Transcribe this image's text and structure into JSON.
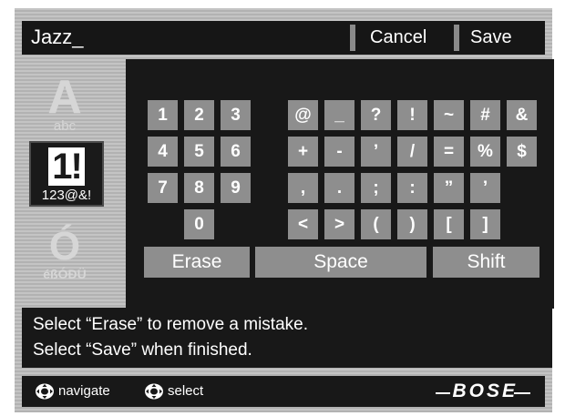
{
  "top_bar": {
    "entry_text": "Jazz_",
    "cancel_label": "Cancel",
    "save_label": "Save"
  },
  "modes": {
    "alpha": {
      "glyph": "A",
      "label": "abc"
    },
    "symbols": {
      "glyph": "1!",
      "label": "123@&!"
    },
    "accented": {
      "glyph": "Ó",
      "label": "éßÓÐÜ"
    }
  },
  "keys": {
    "k1": "1",
    "k2": "2",
    "k3": "3",
    "k4": "4",
    "k5": "5",
    "k6": "6",
    "k7": "7",
    "k8": "8",
    "k9": "9",
    "k0": "0",
    "at": "@",
    "underscore": "_",
    "question": "?",
    "exclaim": "!",
    "tilde": "~",
    "hash": "#",
    "amp": "&",
    "plus": "+",
    "minus": "-",
    "apostrophe": "’",
    "slash": "/",
    "equals": "=",
    "percent": "%",
    "dollar": "$",
    "comma": ",",
    "period": ".",
    "semicolon": ";",
    "colon": ":",
    "dquote": "”",
    "squote": "’",
    "lt": "<",
    "gt": ">",
    "lparen": "(",
    "rparen": ")",
    "lbracket": "[",
    "rbracket": "]",
    "erase": "Erase",
    "space": "Space",
    "shift": "Shift"
  },
  "hint": {
    "line1": "Select “Erase” to remove a mistake.",
    "line2": "Select “Save” when finished."
  },
  "bottom_bar": {
    "navigate_label": "navigate",
    "select_label": "select",
    "brand": "BOSE"
  }
}
